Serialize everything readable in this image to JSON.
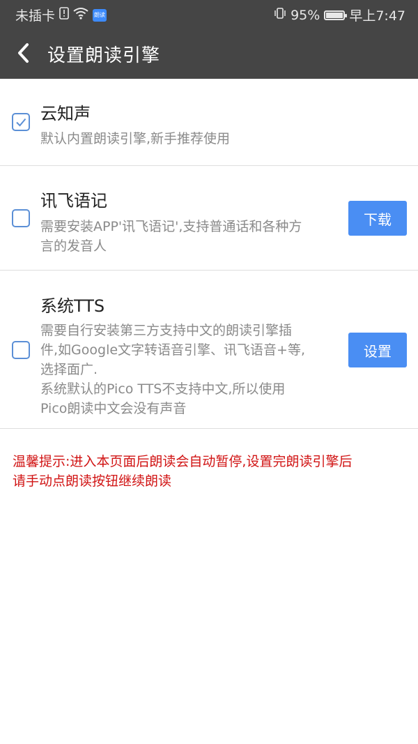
{
  "status_bar": {
    "carrier": "未插卡",
    "app_badge": "朗读",
    "battery_text": "95%",
    "battery_level": 0.95,
    "time": "早上7:47"
  },
  "header": {
    "title": "设置朗读引擎",
    "back_icon": "chevron-left-icon"
  },
  "engines": [
    {
      "name": "云知声",
      "desc": "默认内置朗读引擎,新手推荐使用",
      "checked": true,
      "button": null
    },
    {
      "name": "讯飞语记",
      "desc_lines": [
        "需要安装APP'讯飞语记',支持普通话和各种方",
        "言的发音人"
      ],
      "checked": false,
      "button": "下载"
    },
    {
      "name": "系统TTS",
      "desc_lines": [
        "需要自行安装第三方支持中文的朗读引擎插",
        "件,如Google文字转语音引擎、讯飞语音+等,",
        "选择面广.",
        "系统默认的Pico TTS不支持中文,所以使用",
        "Pico朗读中文会没有声音"
      ],
      "checked": false,
      "button": "设置"
    }
  ],
  "tip_lines": [
    "温馨提示:进入本页面后朗读会自动暂停,设置完朗读引擎后",
    "请手动点朗读按钮继续朗读"
  ],
  "colors": {
    "header_bg": "#454545",
    "accent_blue": "#4a8ef3",
    "tip_red": "#d11414"
  }
}
